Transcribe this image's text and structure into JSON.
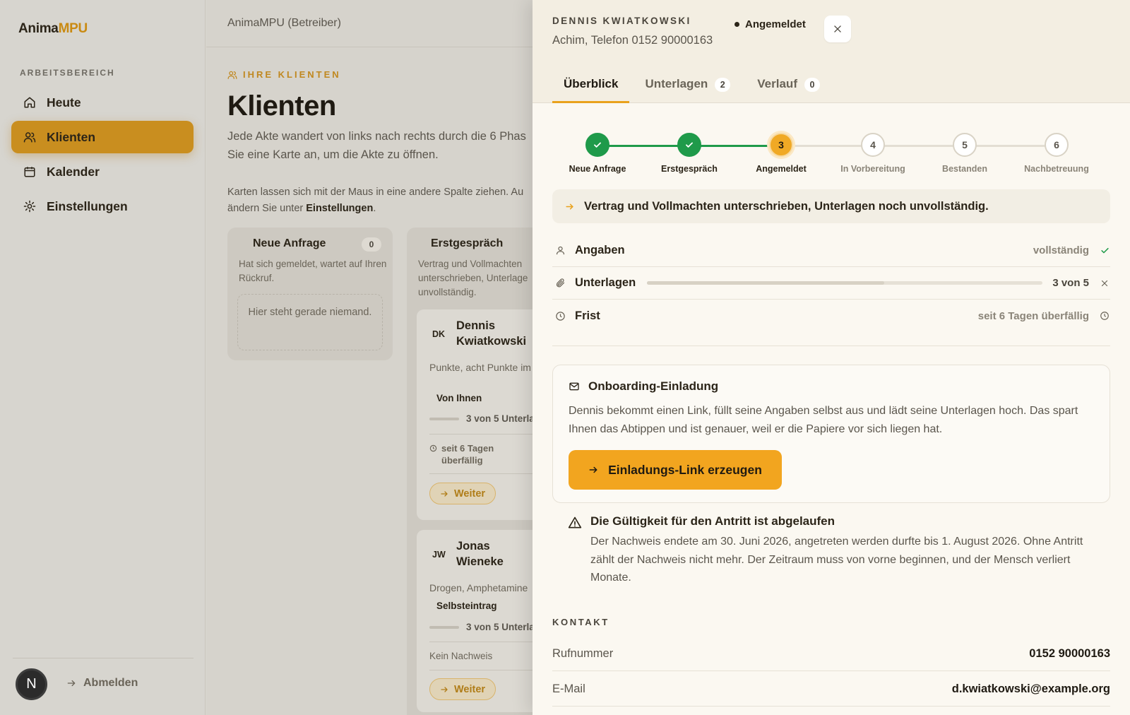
{
  "app": {
    "logo_part1": "Anima",
    "logo_part2": "MPU"
  },
  "sidebar": {
    "section_label": "ARBEITSBEREICH",
    "items": [
      {
        "label": "Heute",
        "icon": "home-icon",
        "active": false
      },
      {
        "label": "Klienten",
        "icon": "users-icon",
        "active": true
      },
      {
        "label": "Kalender",
        "icon": "calendar-icon",
        "active": false
      },
      {
        "label": "Einstellungen",
        "icon": "gear-icon",
        "active": false
      }
    ],
    "avatar_initial": "N",
    "logout_label": "Abmelden"
  },
  "main": {
    "topbar_title": "AnimaMPU (Betreiber)",
    "eyebrow": "IHRE KLIENTEN",
    "title": "Klienten",
    "intro_line1": "Jede Akte wandert von links nach rechts durch die 6 Phas",
    "intro_line2": "Sie eine Karte an, um die Akte zu öffnen.",
    "note_line1": "Karten lassen sich mit der Maus in eine andere Spalte ziehen. Au",
    "note_line2_prefix": "ändern Sie unter ",
    "note_line2_link": "Einstellungen",
    "note_line2_suffix": ".",
    "columns": [
      {
        "title": "Neue Anfrage",
        "count": "0",
        "desc": "Hat sich gemeldet, wartet auf Ihren Rückruf.",
        "empty_text": "Hier steht gerade niemand."
      },
      {
        "title": "Erstgespräch",
        "desc": "Vertrag und Vollmachten unterschrieben, Unterlage unvollständig.",
        "cards": [
          {
            "initials": "DK",
            "name_line1": "Dennis",
            "name_line2": "Kwiatkowski",
            "desc": "Punkte, acht Punkte im Register",
            "tag": "Von Ihnen",
            "progress": "3 von 5 Unterla",
            "deadline_line1": "seit 6 Tagen",
            "deadline_line2": "überfällig",
            "button": "Weiter"
          },
          {
            "initials": "JW",
            "name_line1": "Jonas",
            "name_line2": "Wieneke",
            "desc": "Drogen, Amphetamine",
            "tag": "Selbsteintrag",
            "progress": "3 von 5 Unterla",
            "muted": "Kein Nachweis",
            "button": "Weiter"
          }
        ]
      }
    ]
  },
  "drawer": {
    "client_name": "DENNIS KWIATKOWSKI",
    "client_sub": "Achim, Telefon 0152 90000163",
    "status": "Angemeldet",
    "tabs": [
      {
        "label": "Überblick",
        "active": true
      },
      {
        "label": "Unterlagen",
        "badge": "2",
        "active": false
      },
      {
        "label": "Verlauf",
        "badge": "0",
        "active": false
      }
    ],
    "steps": [
      {
        "label": "Neue Anfrage",
        "state": "done",
        "num": "1"
      },
      {
        "label": "Erstgespräch",
        "state": "done",
        "num": "2"
      },
      {
        "label": "Angemeldet",
        "state": "current",
        "num": "3"
      },
      {
        "label": "In Vorbereitung",
        "state": "todo",
        "num": "4"
      },
      {
        "label": "Bestanden",
        "state": "todo",
        "num": "5"
      },
      {
        "label": "Nachbetreuung",
        "state": "todo",
        "num": "6"
      }
    ],
    "summary": "Vertrag und Vollmachten unterschrieben, Unterlagen noch unvollständig.",
    "rows": {
      "angaben": {
        "label": "Angaben",
        "value": "vollständig"
      },
      "unterlagen": {
        "label": "Unterlagen",
        "value": "3 von 5",
        "progress": 0.6
      },
      "frist": {
        "label": "Frist",
        "value": "seit 6 Tagen überfällig"
      }
    },
    "invite": {
      "title": "Onboarding-Einladung",
      "text": "Dennis bekommt einen Link, füllt seine Angaben selbst aus und lädt seine Unterlagen hoch. Das spart Ihnen das Abtippen und ist genauer, weil er die Papiere vor sich liegen hat.",
      "button": "Einladungs-Link erzeugen"
    },
    "warning": {
      "title": "Die Gültigkeit für den Antritt ist abgelaufen",
      "text": "Der Nachweis endete am 30. Juni 2026, angetreten werden durfte bis 1. August 2026. Ohne Antritt zählt der Nachweis nicht mehr. Der Zeitraum muss von vorne beginnen, und der Mensch verliert Monate."
    },
    "kontakt": {
      "label": "KONTAKT",
      "phone_label": "Rufnummer",
      "phone": "0152 90000163",
      "email_label": "E-Mail",
      "email": "d.kwiatkowski@example.org"
    }
  },
  "colors": {
    "accent": "#f2a51f",
    "accent_dark": "#c98a12",
    "success": "#1f9a4a",
    "text": "#2b2418"
  }
}
